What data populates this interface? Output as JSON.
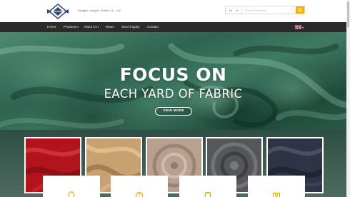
{
  "header": {
    "company_name": "Jiangyin Jinuguo Textile Co., Ltd.",
    "logo_icon": "diamond-logo-icon",
    "search": {
      "category_value": "All",
      "placeholder": "Search Products",
      "button_icon": "search-icon"
    }
  },
  "nav": {
    "items": [
      {
        "label": "Home"
      },
      {
        "label": "Products"
      },
      {
        "label": "About Us"
      },
      {
        "label": "News"
      },
      {
        "label": "Send Inquiry"
      },
      {
        "label": "Contact"
      }
    ],
    "language_icon": "uk-flag-icon"
  },
  "hero": {
    "title": "FOCUS ON",
    "subtitle": "EACH YARD OF FABRIC",
    "button_label": "VIEW MORE"
  },
  "products": {
    "thumbnails": [
      {
        "name": "red-fabric-thumbnail",
        "color": "#b3141c"
      },
      {
        "name": "camel-fabric-thumbnail",
        "color": "#c9a070"
      },
      {
        "name": "beige-fabric-thumbnail",
        "color": "#b8a08e"
      },
      {
        "name": "grey-fabric-thumbnail",
        "color": "#55575a"
      },
      {
        "name": "navy-fabric-thumbnail",
        "color": "#2f3445"
      }
    ]
  },
  "features": {
    "icons": [
      "bulb-icon",
      "globe-icon",
      "clipboard-icon",
      "camera-icon"
    ]
  },
  "colors": {
    "accent": "#f0b400",
    "nav_bg": "#2a2a2a",
    "hero_green": "#3f7a62"
  }
}
